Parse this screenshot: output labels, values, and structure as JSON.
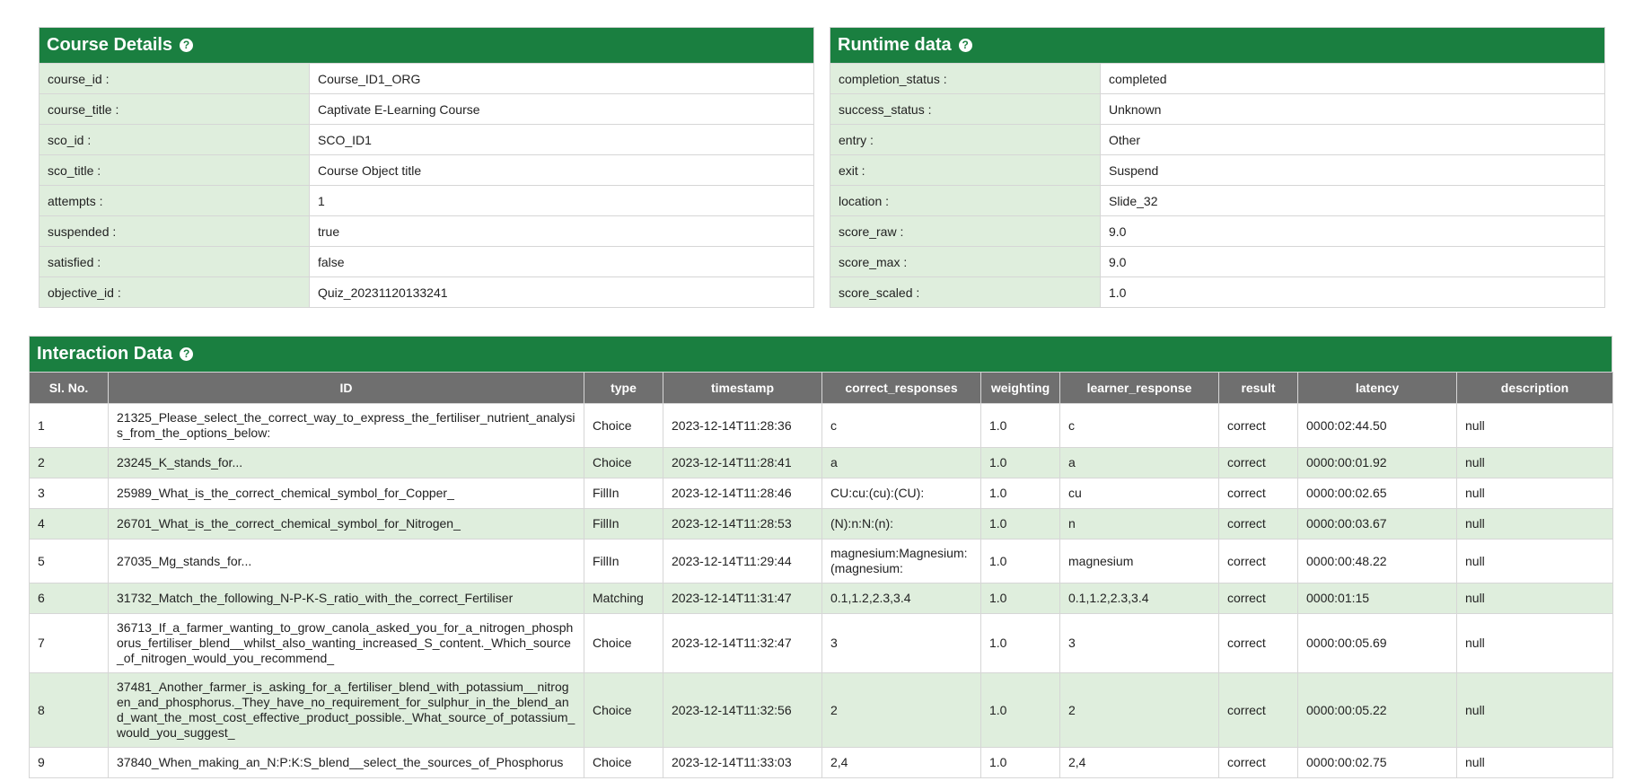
{
  "course_details": {
    "title": "Course Details",
    "help": "?",
    "rows": [
      {
        "key": "course_id :",
        "value": "Course_ID1_ORG"
      },
      {
        "key": "course_title :",
        "value": "Captivate E-Learning Course"
      },
      {
        "key": "sco_id :",
        "value": "SCO_ID1"
      },
      {
        "key": "sco_title :",
        "value": "Course Object title"
      },
      {
        "key": "attempts :",
        "value": "1"
      },
      {
        "key": "suspended :",
        "value": "true"
      },
      {
        "key": "satisfied :",
        "value": "false"
      },
      {
        "key": "objective_id :",
        "value": "Quiz_20231120133241"
      }
    ]
  },
  "runtime_data": {
    "title": "Runtime data",
    "help": "?",
    "rows": [
      {
        "key": "completion_status :",
        "value": "completed"
      },
      {
        "key": "success_status :",
        "value": "Unknown"
      },
      {
        "key": "entry :",
        "value": "Other"
      },
      {
        "key": "exit :",
        "value": "Suspend"
      },
      {
        "key": "location :",
        "value": "Slide_32"
      },
      {
        "key": "score_raw :",
        "value": "9.0"
      },
      {
        "key": "score_max :",
        "value": "9.0"
      },
      {
        "key": "score_scaled :",
        "value": "1.0"
      }
    ]
  },
  "interaction_data": {
    "title": "Interaction Data",
    "help": "?",
    "columns": [
      "Sl. No.",
      "ID",
      "type",
      "timestamp",
      "correct_responses",
      "weighting",
      "learner_response",
      "result",
      "latency",
      "description"
    ],
    "rows": [
      {
        "no": "1",
        "id": "21325_Please_select_the_correct_way_to_express_the_fertiliser_nutrient_analysis_from_the_options_below:",
        "type": "Choice",
        "timestamp": "2023-12-14T11:28:36",
        "correct": "c",
        "weighting": "1.0",
        "learner": "c",
        "result": "correct",
        "latency": "0000:02:44.50",
        "description": "null"
      },
      {
        "no": "2",
        "id": "23245_K_stands_for...",
        "type": "Choice",
        "timestamp": "2023-12-14T11:28:41",
        "correct": "a",
        "weighting": "1.0",
        "learner": "a",
        "result": "correct",
        "latency": "0000:00:01.92",
        "description": "null"
      },
      {
        "no": "3",
        "id": "25989_What_is_the_correct_chemical_symbol_for_Copper_",
        "type": "FillIn",
        "timestamp": "2023-12-14T11:28:46",
        "correct": "CU:cu:(cu):(CU):",
        "weighting": "1.0",
        "learner": "cu",
        "result": "correct",
        "latency": "0000:00:02.65",
        "description": "null"
      },
      {
        "no": "4",
        "id": "26701_What_is_the_correct_chemical_symbol_for_Nitrogen_",
        "type": "FillIn",
        "timestamp": "2023-12-14T11:28:53",
        "correct": "(N):n:N:(n):",
        "weighting": "1.0",
        "learner": "n",
        "result": "correct",
        "latency": "0000:00:03.67",
        "description": "null"
      },
      {
        "no": "5",
        "id": "27035_Mg_stands_for...",
        "type": "FillIn",
        "timestamp": "2023-12-14T11:29:44",
        "correct": "magnesium:Magnesium:(magnesium:",
        "weighting": "1.0",
        "learner": "magnesium",
        "result": "correct",
        "latency": "0000:00:48.22",
        "description": "null"
      },
      {
        "no": "6",
        "id": "31732_Match_the_following_N-P-K-S_ratio_with_the_correct_Fertiliser",
        "type": "Matching",
        "timestamp": "2023-12-14T11:31:47",
        "correct": "0.1,1.2,2.3,3.4",
        "weighting": "1.0",
        "learner": "0.1,1.2,2.3,3.4",
        "result": "correct",
        "latency": "0000:01:15",
        "description": "null"
      },
      {
        "no": "7",
        "id": "36713_If_a_farmer_wanting_to_grow_canola_asked_you_for_a_nitrogen_phosphorus_fertiliser_blend__whilst_also_wanting_increased_S_content._Which_source_of_nitrogen_would_you_recommend_",
        "type": "Choice",
        "timestamp": "2023-12-14T11:32:47",
        "correct": "3",
        "weighting": "1.0",
        "learner": "3",
        "result": "correct",
        "latency": "0000:00:05.69",
        "description": "null"
      },
      {
        "no": "8",
        "id": "37481_Another_farmer_is_asking_for_a_fertiliser_blend_with_potassium__nitrogen_and_phosphorus._They_have_no_requirement_for_sulphur_in_the_blend_and_want_the_most_cost_effective_product_possible._What_source_of_potassium_would_you_suggest_",
        "type": "Choice",
        "timestamp": "2023-12-14T11:32:56",
        "correct": "2",
        "weighting": "1.0",
        "learner": "2",
        "result": "correct",
        "latency": "0000:00:05.22",
        "description": "null"
      },
      {
        "no": "9",
        "id": "37840_When_making_an_N:P:K:S_blend__select_the_sources_of_Phosphorus",
        "type": "Choice",
        "timestamp": "2023-12-14T11:33:03",
        "correct": "2,4",
        "weighting": "1.0",
        "learner": "2,4",
        "result": "correct",
        "latency": "0000:00:02.75",
        "description": "null"
      }
    ]
  }
}
